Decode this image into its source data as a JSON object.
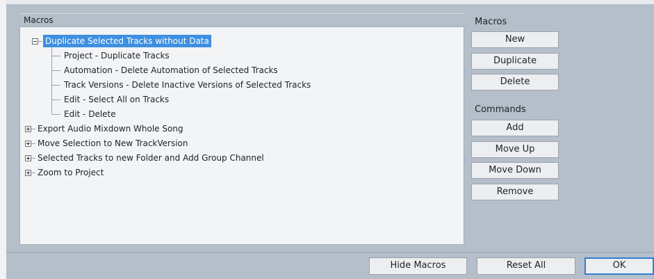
{
  "tree_group": {
    "label": "Macros",
    "macros": [
      {
        "name": "Duplicate Selected Tracks without Data",
        "expanded": true,
        "selected": true,
        "commands": [
          "Project - Duplicate Tracks",
          "Automation - Delete Automation of Selected Tracks",
          "Track Versions - Delete Inactive Versions of Selected Tracks",
          "Edit - Select All on Tracks",
          "Edit - Delete"
        ]
      },
      {
        "name": "Export Audio Mixdown Whole Song",
        "expanded": false
      },
      {
        "name": "Move Selection to New TrackVersion",
        "expanded": false
      },
      {
        "name": "Selected Tracks to new Folder and Add Group Channel",
        "expanded": false
      },
      {
        "name": "Zoom to Project",
        "expanded": false
      }
    ]
  },
  "macros_panel": {
    "label": "Macros",
    "new_label": "New",
    "duplicate_label": "Duplicate",
    "delete_label": "Delete"
  },
  "commands_panel": {
    "label": "Commands",
    "add_label": "Add",
    "move_up_label": "Move Up",
    "move_down_label": "Move Down",
    "remove_label": "Remove"
  },
  "footer": {
    "hide_macros_label": "Hide Macros",
    "reset_all_label": "Reset All",
    "ok_label": "OK"
  },
  "colors": {
    "background": "#b4bfca",
    "selection": "#3d8fe0",
    "default_button_border": "#2f7fd2"
  }
}
